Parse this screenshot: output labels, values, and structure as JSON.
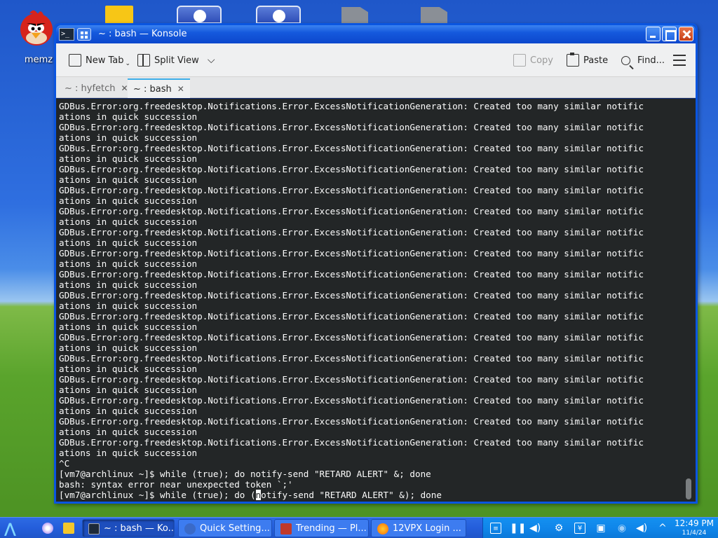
{
  "desktop": {
    "icon_label": "memz"
  },
  "window": {
    "title": "~ : bash — Konsole",
    "app_icon_text": ">_"
  },
  "toolbar": {
    "new_tab": "New Tab",
    "split_view": "Split View",
    "copy": "Copy",
    "paste": "Paste",
    "find": "Find..."
  },
  "tabs": [
    {
      "label": "~ : hyfetch"
    },
    {
      "label": "~ : bash"
    }
  ],
  "terminal": {
    "error_line_a": "GDBus.Error:org.freedesktop.Notifications.Error.ExcessNotificationGeneration: Created too many similar notific",
    "error_line_b": "ations in quick succession",
    "lines_tail": [
      "^C",
      "[vm7@archlinux ~]$ while (true); do notify-send \"RETARD ALERT\" &; done",
      "bash: syntax error near unexpected token `;'"
    ],
    "prompt_before_cursor": "[vm7@archlinux ~]$ while (true); do (",
    "cursor_char": "n",
    "prompt_after_cursor": "otify-send \"RETARD ALERT\" &); done"
  },
  "taskbar": {
    "tasks": [
      {
        "label": "~ : bash — Ko..."
      },
      {
        "label": "Quick Setting..."
      },
      {
        "label": "Trending — Pl..."
      },
      {
        "label": "12VPX Login ..."
      }
    ],
    "time": "12:49 PM",
    "date": "11/4/24"
  },
  "colors": {
    "terminal_bg": "#232627",
    "terminal_fg": "#fcfcfc",
    "tab_accent": "#3daee9"
  }
}
